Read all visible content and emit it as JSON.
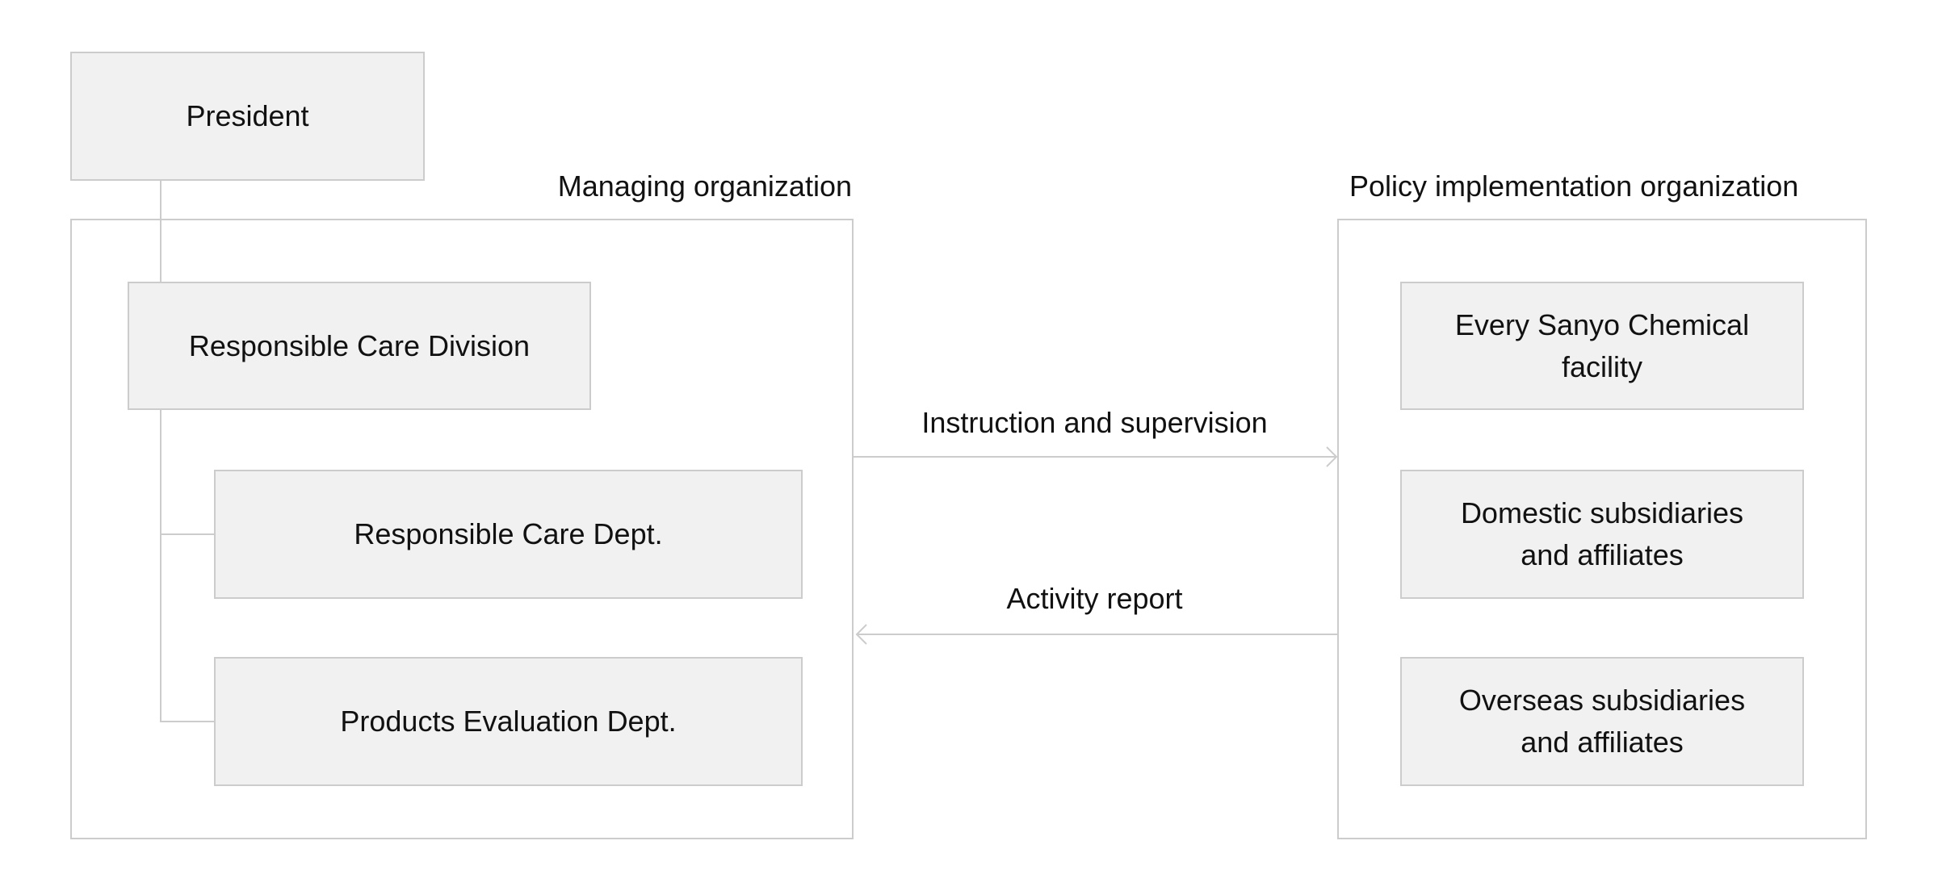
{
  "diagram": {
    "president": "President",
    "managing_org": {
      "title": "Managing organization",
      "division": "Responsible Care Division",
      "departments": [
        "Responsible Care Dept.",
        "Products Evaluation Dept."
      ]
    },
    "policy_org": {
      "title": "Policy implementation organization",
      "units": [
        "Every Sanyo Chemical facility",
        "Domestic subsidiaries and affiliates",
        "Overseas subsidiaries and affiliates"
      ]
    },
    "flows": {
      "instruction": "Instruction and supervision",
      "report": "Activity report"
    },
    "colors": {
      "box_fill": "#f1f1f1",
      "line": "#cccccc",
      "text": "#111111"
    }
  }
}
